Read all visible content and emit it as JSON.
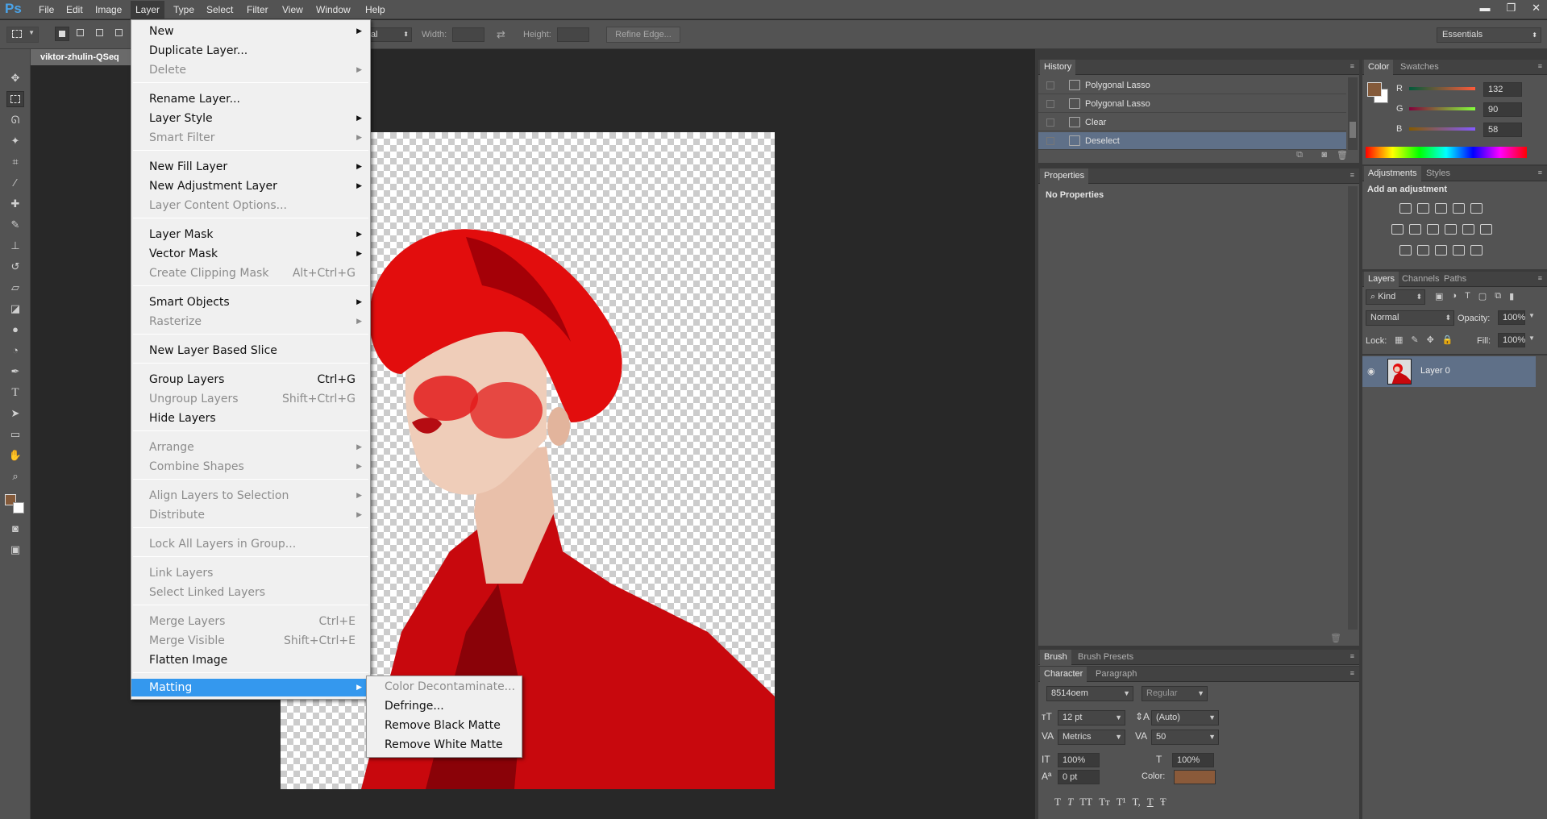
{
  "app": {
    "logo": "Ps"
  },
  "menubar": {
    "items": [
      "File",
      "Edit",
      "Image",
      "Layer",
      "Type",
      "Select",
      "Filter",
      "View",
      "Window",
      "Help"
    ],
    "active": "Layer"
  },
  "window_controls": {
    "minimize": "▬",
    "restore": "❐",
    "close": "✕"
  },
  "options_bar": {
    "style_value": "al",
    "width_label": "Width:",
    "height_label": "Height:",
    "refine_edge": "Refine Edge...",
    "workspace": "Essentials"
  },
  "document": {
    "tab_title": "viktor-zhulin-QSeq"
  },
  "layer_menu": {
    "items": [
      {
        "label": "New",
        "shortcut": "",
        "submenu": true,
        "disabled": false
      },
      {
        "label": "Duplicate Layer...",
        "shortcut": "",
        "submenu": false,
        "disabled": false
      },
      {
        "label": "Delete",
        "shortcut": "",
        "submenu": true,
        "disabled": true
      },
      {
        "label": "Rename Layer...",
        "shortcut": "",
        "submenu": false,
        "disabled": false
      },
      {
        "label": "Layer Style",
        "shortcut": "",
        "submenu": true,
        "disabled": false
      },
      {
        "label": "Smart Filter",
        "shortcut": "",
        "submenu": true,
        "disabled": true
      },
      {
        "label": "New Fill Layer",
        "shortcut": "",
        "submenu": true,
        "disabled": false
      },
      {
        "label": "New Adjustment Layer",
        "shortcut": "",
        "submenu": true,
        "disabled": false
      },
      {
        "label": "Layer Content Options...",
        "shortcut": "",
        "submenu": false,
        "disabled": true
      },
      {
        "label": "Layer Mask",
        "shortcut": "",
        "submenu": true,
        "disabled": false
      },
      {
        "label": "Vector Mask",
        "shortcut": "",
        "submenu": true,
        "disabled": false
      },
      {
        "label": "Create Clipping Mask",
        "shortcut": "Alt+Ctrl+G",
        "submenu": false,
        "disabled": true
      },
      {
        "label": "Smart Objects",
        "shortcut": "",
        "submenu": true,
        "disabled": false
      },
      {
        "label": "Rasterize",
        "shortcut": "",
        "submenu": true,
        "disabled": true
      },
      {
        "label": "New Layer Based Slice",
        "shortcut": "",
        "submenu": false,
        "disabled": false
      },
      {
        "label": "Group Layers",
        "shortcut": "Ctrl+G",
        "submenu": false,
        "disabled": false
      },
      {
        "label": "Ungroup Layers",
        "shortcut": "Shift+Ctrl+G",
        "submenu": false,
        "disabled": true
      },
      {
        "label": "Hide Layers",
        "shortcut": "",
        "submenu": false,
        "disabled": false
      },
      {
        "label": "Arrange",
        "shortcut": "",
        "submenu": true,
        "disabled": true
      },
      {
        "label": "Combine Shapes",
        "shortcut": "",
        "submenu": true,
        "disabled": true
      },
      {
        "label": "Align Layers to Selection",
        "shortcut": "",
        "submenu": true,
        "disabled": true
      },
      {
        "label": "Distribute",
        "shortcut": "",
        "submenu": true,
        "disabled": true
      },
      {
        "label": "Lock All Layers in Group...",
        "shortcut": "",
        "submenu": false,
        "disabled": true
      },
      {
        "label": "Link Layers",
        "shortcut": "",
        "submenu": false,
        "disabled": true
      },
      {
        "label": "Select Linked Layers",
        "shortcut": "",
        "submenu": false,
        "disabled": true
      },
      {
        "label": "Merge Layers",
        "shortcut": "Ctrl+E",
        "submenu": false,
        "disabled": true
      },
      {
        "label": "Merge Visible",
        "shortcut": "Shift+Ctrl+E",
        "submenu": false,
        "disabled": true
      },
      {
        "label": "Flatten Image",
        "shortcut": "",
        "submenu": false,
        "disabled": false
      },
      {
        "label": "Matting",
        "shortcut": "",
        "submenu": true,
        "disabled": false,
        "highlighted": true
      }
    ]
  },
  "matting_submenu": {
    "items": [
      {
        "label": "Color Decontaminate...",
        "disabled": true
      },
      {
        "label": "Defringe...",
        "disabled": false
      },
      {
        "label": "Remove Black Matte",
        "disabled": false
      },
      {
        "label": "Remove White Matte",
        "disabled": false
      }
    ]
  },
  "history": {
    "tab": "History",
    "rows": [
      {
        "label": "Polygonal Lasso",
        "icon": "polygonal-lasso-icon",
        "selected": false
      },
      {
        "label": "Polygonal Lasso",
        "icon": "polygonal-lasso-icon",
        "selected": false
      },
      {
        "label": "Clear",
        "icon": "history-state-icon",
        "selected": false
      },
      {
        "label": "Deselect",
        "icon": "history-state-icon",
        "selected": true
      }
    ]
  },
  "properties": {
    "tab": "Properties",
    "message": "No Properties"
  },
  "brush_tabs": {
    "brush": "Brush",
    "presets": "Brush Presets"
  },
  "character": {
    "tab": "Character",
    "tab2": "Paragraph",
    "font_family": "8514oem",
    "font_style": "Regular",
    "size": "12 pt",
    "leading": "(Auto)",
    "kerning": "Metrics",
    "tracking": "50",
    "vscale": "100%",
    "hscale": "100%",
    "baseline": "0 pt",
    "color_label": "Color:",
    "color": "#8a5a3a",
    "style_buttons": [
      "T",
      "T",
      "TT",
      "Tт",
      "T¹",
      "T,",
      "T",
      "Ŧ"
    ]
  },
  "color_panel": {
    "tab": "Color",
    "tab2": "Swatches",
    "r_label": "R",
    "g_label": "G",
    "b_label": "B",
    "r": "132",
    "g": "90",
    "b": "58",
    "fg_color": "#845a3a"
  },
  "adjustments": {
    "tab": "Adjustments",
    "tab2": "Styles",
    "title": "Add an adjustment"
  },
  "layers": {
    "tab": "Layers",
    "tab2": "Channels",
    "tab3": "Paths",
    "filter": "Kind",
    "blend_mode": "Normal",
    "opacity_label": "Opacity:",
    "opacity": "100%",
    "lock_label": "Lock:",
    "fill_label": "Fill:",
    "fill": "100%",
    "layer_name": "Layer 0"
  },
  "colors": {
    "accent": "#3498ee",
    "menubar": "#535353",
    "workspace": "#282828",
    "red": "#d51414"
  }
}
